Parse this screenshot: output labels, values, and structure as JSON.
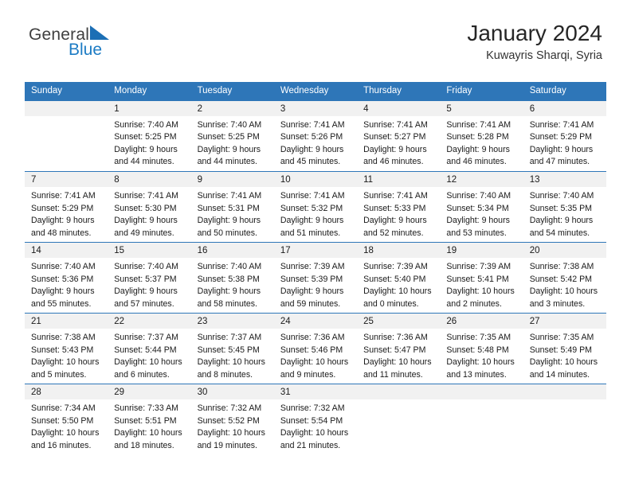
{
  "brand": {
    "word1": "General",
    "word2": "Blue",
    "triangle_color": "#1c6fb5",
    "blue_color": "#1c7bc4"
  },
  "header": {
    "title": "January 2024",
    "location": "Kuwayris Sharqi, Syria"
  },
  "theme": {
    "header_bg": "#2e76b8",
    "daynum_bg": "#f1f1f1",
    "row_divider": "#2e76b8",
    "text": "#1a1a1a"
  },
  "weekdays": [
    "Sunday",
    "Monday",
    "Tuesday",
    "Wednesday",
    "Thursday",
    "Friday",
    "Saturday"
  ],
  "weeks": [
    [
      {
        "day": "",
        "sunrise": "",
        "sunset": "",
        "daylight1": "",
        "daylight2": ""
      },
      {
        "day": "1",
        "sunrise": "Sunrise: 7:40 AM",
        "sunset": "Sunset: 5:25 PM",
        "daylight1": "Daylight: 9 hours",
        "daylight2": "and 44 minutes."
      },
      {
        "day": "2",
        "sunrise": "Sunrise: 7:40 AM",
        "sunset": "Sunset: 5:25 PM",
        "daylight1": "Daylight: 9 hours",
        "daylight2": "and 44 minutes."
      },
      {
        "day": "3",
        "sunrise": "Sunrise: 7:41 AM",
        "sunset": "Sunset: 5:26 PM",
        "daylight1": "Daylight: 9 hours",
        "daylight2": "and 45 minutes."
      },
      {
        "day": "4",
        "sunrise": "Sunrise: 7:41 AM",
        "sunset": "Sunset: 5:27 PM",
        "daylight1": "Daylight: 9 hours",
        "daylight2": "and 46 minutes."
      },
      {
        "day": "5",
        "sunrise": "Sunrise: 7:41 AM",
        "sunset": "Sunset: 5:28 PM",
        "daylight1": "Daylight: 9 hours",
        "daylight2": "and 46 minutes."
      },
      {
        "day": "6",
        "sunrise": "Sunrise: 7:41 AM",
        "sunset": "Sunset: 5:29 PM",
        "daylight1": "Daylight: 9 hours",
        "daylight2": "and 47 minutes."
      }
    ],
    [
      {
        "day": "7",
        "sunrise": "Sunrise: 7:41 AM",
        "sunset": "Sunset: 5:29 PM",
        "daylight1": "Daylight: 9 hours",
        "daylight2": "and 48 minutes."
      },
      {
        "day": "8",
        "sunrise": "Sunrise: 7:41 AM",
        "sunset": "Sunset: 5:30 PM",
        "daylight1": "Daylight: 9 hours",
        "daylight2": "and 49 minutes."
      },
      {
        "day": "9",
        "sunrise": "Sunrise: 7:41 AM",
        "sunset": "Sunset: 5:31 PM",
        "daylight1": "Daylight: 9 hours",
        "daylight2": "and 50 minutes."
      },
      {
        "day": "10",
        "sunrise": "Sunrise: 7:41 AM",
        "sunset": "Sunset: 5:32 PM",
        "daylight1": "Daylight: 9 hours",
        "daylight2": "and 51 minutes."
      },
      {
        "day": "11",
        "sunrise": "Sunrise: 7:41 AM",
        "sunset": "Sunset: 5:33 PM",
        "daylight1": "Daylight: 9 hours",
        "daylight2": "and 52 minutes."
      },
      {
        "day": "12",
        "sunrise": "Sunrise: 7:40 AM",
        "sunset": "Sunset: 5:34 PM",
        "daylight1": "Daylight: 9 hours",
        "daylight2": "and 53 minutes."
      },
      {
        "day": "13",
        "sunrise": "Sunrise: 7:40 AM",
        "sunset": "Sunset: 5:35 PM",
        "daylight1": "Daylight: 9 hours",
        "daylight2": "and 54 minutes."
      }
    ],
    [
      {
        "day": "14",
        "sunrise": "Sunrise: 7:40 AM",
        "sunset": "Sunset: 5:36 PM",
        "daylight1": "Daylight: 9 hours",
        "daylight2": "and 55 minutes."
      },
      {
        "day": "15",
        "sunrise": "Sunrise: 7:40 AM",
        "sunset": "Sunset: 5:37 PM",
        "daylight1": "Daylight: 9 hours",
        "daylight2": "and 57 minutes."
      },
      {
        "day": "16",
        "sunrise": "Sunrise: 7:40 AM",
        "sunset": "Sunset: 5:38 PM",
        "daylight1": "Daylight: 9 hours",
        "daylight2": "and 58 minutes."
      },
      {
        "day": "17",
        "sunrise": "Sunrise: 7:39 AM",
        "sunset": "Sunset: 5:39 PM",
        "daylight1": "Daylight: 9 hours",
        "daylight2": "and 59 minutes."
      },
      {
        "day": "18",
        "sunrise": "Sunrise: 7:39 AM",
        "sunset": "Sunset: 5:40 PM",
        "daylight1": "Daylight: 10 hours",
        "daylight2": "and 0 minutes."
      },
      {
        "day": "19",
        "sunrise": "Sunrise: 7:39 AM",
        "sunset": "Sunset: 5:41 PM",
        "daylight1": "Daylight: 10 hours",
        "daylight2": "and 2 minutes."
      },
      {
        "day": "20",
        "sunrise": "Sunrise: 7:38 AM",
        "sunset": "Sunset: 5:42 PM",
        "daylight1": "Daylight: 10 hours",
        "daylight2": "and 3 minutes."
      }
    ],
    [
      {
        "day": "21",
        "sunrise": "Sunrise: 7:38 AM",
        "sunset": "Sunset: 5:43 PM",
        "daylight1": "Daylight: 10 hours",
        "daylight2": "and 5 minutes."
      },
      {
        "day": "22",
        "sunrise": "Sunrise: 7:37 AM",
        "sunset": "Sunset: 5:44 PM",
        "daylight1": "Daylight: 10 hours",
        "daylight2": "and 6 minutes."
      },
      {
        "day": "23",
        "sunrise": "Sunrise: 7:37 AM",
        "sunset": "Sunset: 5:45 PM",
        "daylight1": "Daylight: 10 hours",
        "daylight2": "and 8 minutes."
      },
      {
        "day": "24",
        "sunrise": "Sunrise: 7:36 AM",
        "sunset": "Sunset: 5:46 PM",
        "daylight1": "Daylight: 10 hours",
        "daylight2": "and 9 minutes."
      },
      {
        "day": "25",
        "sunrise": "Sunrise: 7:36 AM",
        "sunset": "Sunset: 5:47 PM",
        "daylight1": "Daylight: 10 hours",
        "daylight2": "and 11 minutes."
      },
      {
        "day": "26",
        "sunrise": "Sunrise: 7:35 AM",
        "sunset": "Sunset: 5:48 PM",
        "daylight1": "Daylight: 10 hours",
        "daylight2": "and 13 minutes."
      },
      {
        "day": "27",
        "sunrise": "Sunrise: 7:35 AM",
        "sunset": "Sunset: 5:49 PM",
        "daylight1": "Daylight: 10 hours",
        "daylight2": "and 14 minutes."
      }
    ],
    [
      {
        "day": "28",
        "sunrise": "Sunrise: 7:34 AM",
        "sunset": "Sunset: 5:50 PM",
        "daylight1": "Daylight: 10 hours",
        "daylight2": "and 16 minutes."
      },
      {
        "day": "29",
        "sunrise": "Sunrise: 7:33 AM",
        "sunset": "Sunset: 5:51 PM",
        "daylight1": "Daylight: 10 hours",
        "daylight2": "and 18 minutes."
      },
      {
        "day": "30",
        "sunrise": "Sunrise: 7:32 AM",
        "sunset": "Sunset: 5:52 PM",
        "daylight1": "Daylight: 10 hours",
        "daylight2": "and 19 minutes."
      },
      {
        "day": "31",
        "sunrise": "Sunrise: 7:32 AM",
        "sunset": "Sunset: 5:54 PM",
        "daylight1": "Daylight: 10 hours",
        "daylight2": "and 21 minutes."
      },
      {
        "day": "",
        "sunrise": "",
        "sunset": "",
        "daylight1": "",
        "daylight2": ""
      },
      {
        "day": "",
        "sunrise": "",
        "sunset": "",
        "daylight1": "",
        "daylight2": ""
      },
      {
        "day": "",
        "sunrise": "",
        "sunset": "",
        "daylight1": "",
        "daylight2": ""
      }
    ]
  ]
}
